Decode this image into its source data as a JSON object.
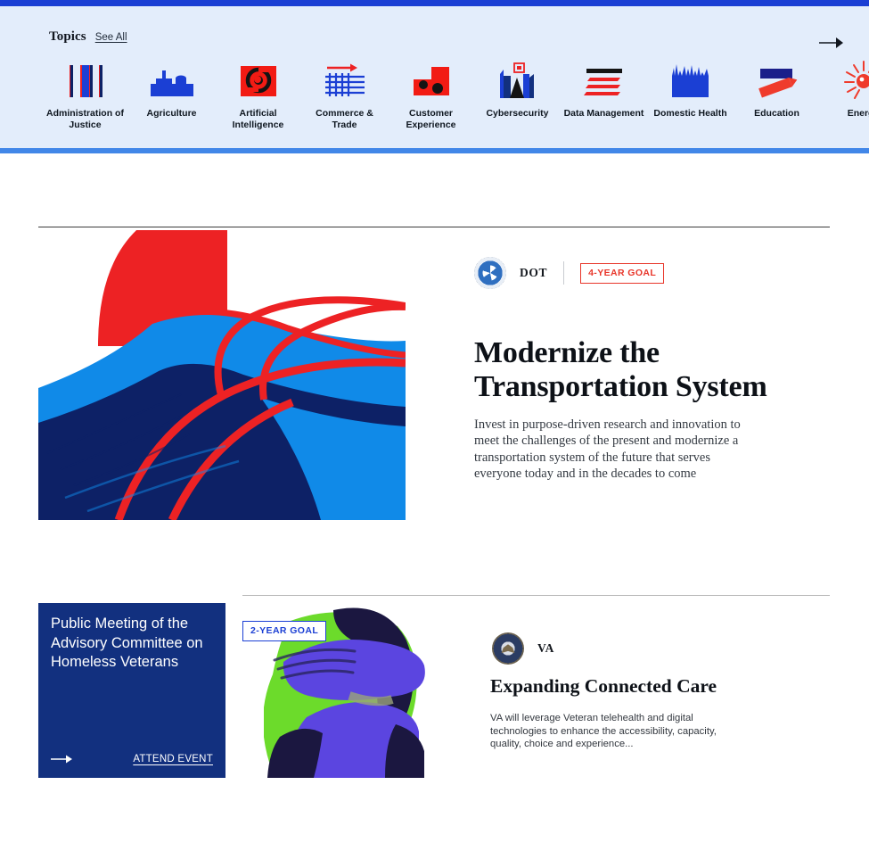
{
  "topics_panel": {
    "heading": "Topics",
    "see_all_label": "See All",
    "next_arrow_icon": "arrow-right-icon",
    "accent_border_top": "#1b3fd4",
    "accent_border_bottom": "#4287e8",
    "background": "#e3edfb",
    "items": [
      {
        "label": "Administration of Justice",
        "icon": "justice-pillars-icon"
      },
      {
        "label": "Agriculture",
        "icon": "farm-silo-icon"
      },
      {
        "label": "Artificial Intelligence",
        "icon": "ai-node-icon"
      },
      {
        "label": "Commerce & Trade",
        "icon": "commerce-chart-icon"
      },
      {
        "label": "Customer Experience",
        "icon": "customer-face-icon"
      },
      {
        "label": "Cybersecurity",
        "icon": "cyber-city-lock-icon"
      },
      {
        "label": "Data Management",
        "icon": "data-stack-icon"
      },
      {
        "label": "Domestic Health",
        "icon": "health-skyline-icon"
      },
      {
        "label": "Education",
        "icon": "education-book-pencil-icon"
      },
      {
        "label": "Energy",
        "icon": "energy-sun-icon"
      }
    ]
  },
  "dot_feature": {
    "agency_seal_icon": "dot-seal-icon",
    "agency_abbr": "DOT",
    "goal_badge": "4-YEAR GOAL",
    "goal_badge_color": "#e8362a",
    "title": "Modernize the Transportation System",
    "description": "Invest in purpose-driven research and innovation to meet the challenges of the present and modernize a transportation system of the future that serves everyone today and in the decades to come",
    "artwork_name": "abstract-highway-illustration",
    "artwork_colors": [
      "#ed2224",
      "#108ae8",
      "#0d2166"
    ]
  },
  "event_card": {
    "title": "Public Meeting of the Advisory Committee on Homeless Veterans",
    "cta_label": "ATTEND EVENT",
    "arrow_icon": "arrow-right-icon",
    "background": "#12307f"
  },
  "va_feature": {
    "goal_badge": "2-YEAR GOAL",
    "goal_badge_color": "#1b3fd4",
    "agency_seal_icon": "va-seal-icon",
    "agency_abbr": "VA",
    "title": "Expanding Connected Care",
    "description": "VA will leverage Veteran telehealth and digital technologies to enhance the accessibility, capacity, quality, choice and experience...",
    "artwork_name": "veteran-portrait-illustration",
    "artwork_colors": [
      "#6cdb2b",
      "#5b45e0",
      "#1b1740"
    ]
  }
}
